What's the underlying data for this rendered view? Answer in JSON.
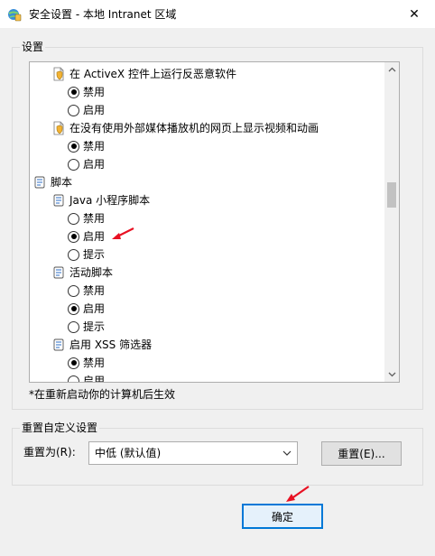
{
  "window": {
    "title": "安全设置 - 本地 Intranet 区域",
    "close_glyph": "✕"
  },
  "settings_group": {
    "label": "设置",
    "rows": [
      {
        "kind": "setting",
        "indent": 1,
        "icon": "shield-page-icon",
        "label": "在 ActiveX 控件上运行反恶意软件"
      },
      {
        "kind": "option",
        "indent": 2,
        "checked": true,
        "label": "禁用"
      },
      {
        "kind": "option",
        "indent": 2,
        "checked": false,
        "label": "启用"
      },
      {
        "kind": "setting",
        "indent": 1,
        "icon": "shield-page-icon",
        "label": "在没有使用外部媒体播放机的网页上显示视频和动画"
      },
      {
        "kind": "option",
        "indent": 2,
        "checked": true,
        "label": "禁用"
      },
      {
        "kind": "option",
        "indent": 2,
        "checked": false,
        "label": "启用"
      },
      {
        "kind": "category",
        "indent": 0,
        "icon": "script-icon",
        "label": "脚本"
      },
      {
        "kind": "setting",
        "indent": 1,
        "icon": "script-icon",
        "label": "Java 小程序脚本"
      },
      {
        "kind": "option",
        "indent": 2,
        "checked": false,
        "label": "禁用"
      },
      {
        "kind": "option",
        "indent": 2,
        "checked": true,
        "label": "启用"
      },
      {
        "kind": "option",
        "indent": 2,
        "checked": false,
        "label": "提示"
      },
      {
        "kind": "setting",
        "indent": 1,
        "icon": "script-icon",
        "label": "活动脚本"
      },
      {
        "kind": "option",
        "indent": 2,
        "checked": false,
        "label": "禁用"
      },
      {
        "kind": "option",
        "indent": 2,
        "checked": true,
        "label": "启用"
      },
      {
        "kind": "option",
        "indent": 2,
        "checked": false,
        "label": "提示"
      },
      {
        "kind": "setting",
        "indent": 1,
        "icon": "script-icon",
        "label": "启用 XSS 筛选器"
      },
      {
        "kind": "option",
        "indent": 2,
        "checked": true,
        "label": "禁用"
      },
      {
        "kind": "option",
        "indent": 2,
        "checked": false,
        "label": "启用"
      }
    ],
    "note": "*在重新启动你的计算机后生效"
  },
  "reset_group": {
    "label": "重置自定义设置",
    "reset_to_label": "重置为(R):",
    "combo_value": "中低 (默认值)",
    "reset_button": "重置(E)..."
  },
  "footer": {
    "ok_button": "确定"
  },
  "annotation_color": "#e81123"
}
